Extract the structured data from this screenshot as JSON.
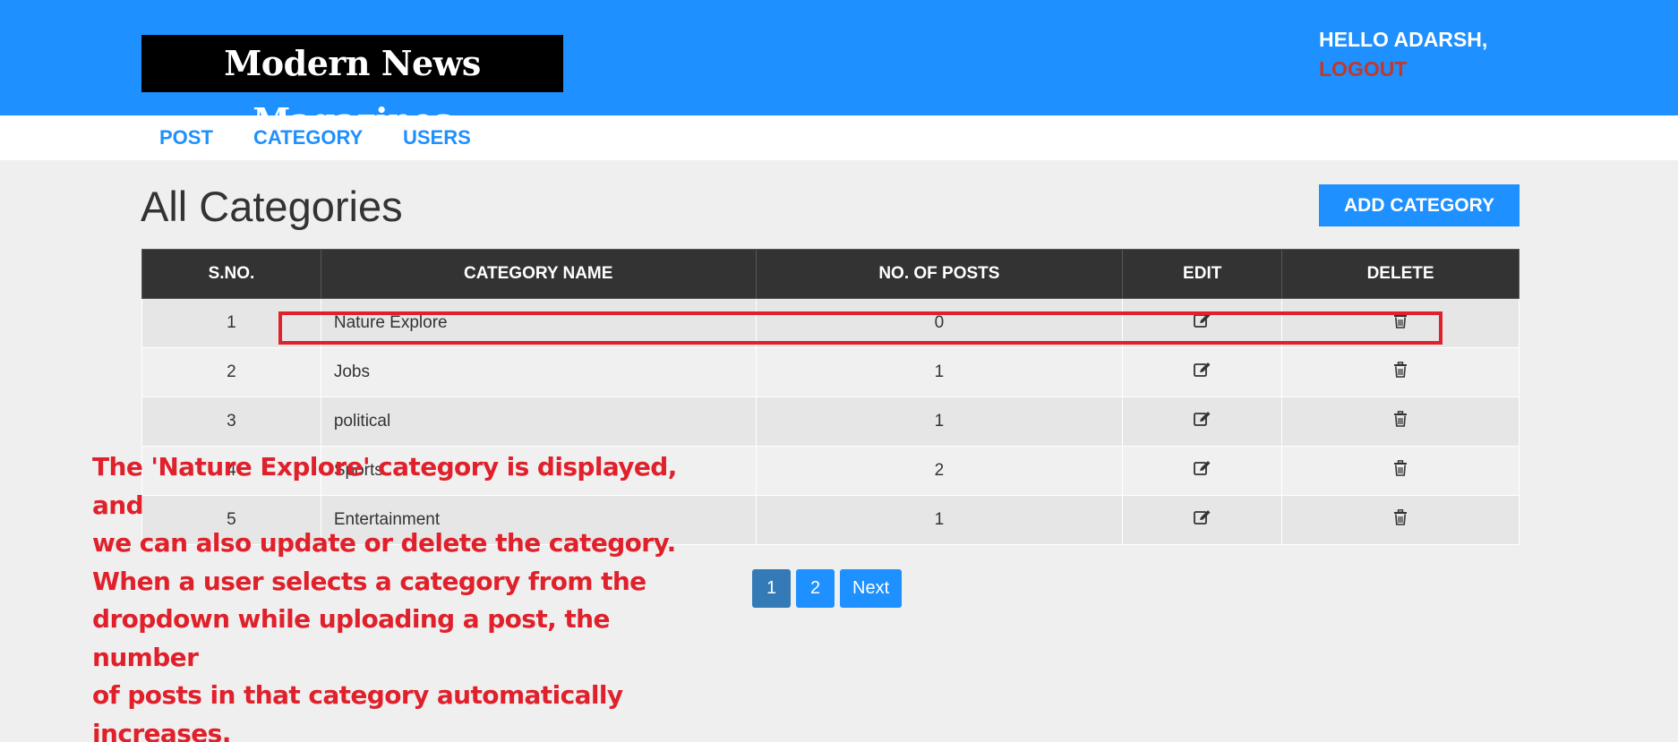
{
  "header": {
    "logo": "Modern News Magazines",
    "greeting": "HELLO ADARSH,",
    "logout": "LOGOUT",
    "background_color": "#1e90ff"
  },
  "nav": {
    "items": [
      {
        "label": "POST"
      },
      {
        "label": "CATEGORY"
      },
      {
        "label": "USERS"
      }
    ]
  },
  "main": {
    "title": "All Categories",
    "add_button": "ADD CATEGORY"
  },
  "table": {
    "columns": [
      "S.NO.",
      "CATEGORY NAME",
      "NO. OF POSTS",
      "EDIT",
      "DELETE"
    ],
    "rows": [
      {
        "sno": "1",
        "name": "Nature Explore",
        "posts": "0"
      },
      {
        "sno": "2",
        "name": "Jobs",
        "posts": "1"
      },
      {
        "sno": "3",
        "name": "political",
        "posts": "1"
      },
      {
        "sno": "4",
        "name": "Sports",
        "posts": "2"
      },
      {
        "sno": "5",
        "name": "Entertainment",
        "posts": "1"
      }
    ],
    "edit_icon": "edit-icon",
    "delete_icon": "trash-icon"
  },
  "pagination": {
    "pages": [
      "1",
      "2"
    ],
    "active": "1",
    "next": "Next"
  },
  "annotation": {
    "text": "The 'Nature Explore' category is displayed, and\nwe can also update or delete the category.\nWhen a user selects a category from the\ndropdown while uploading a post, the number\nof posts in that category automatically\nincreases.",
    "color": "#e0202a"
  }
}
